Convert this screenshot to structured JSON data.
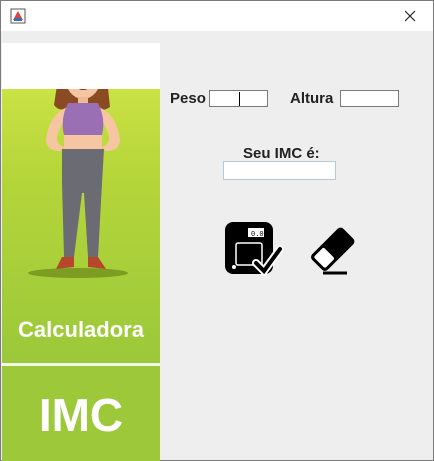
{
  "window": {
    "title": "",
    "icons": {
      "app": "calculator-app-icon",
      "close": "close-icon"
    }
  },
  "sidebar": {
    "image": "woman-illustration",
    "caption_line1": "Calculadora",
    "caption_line2": "IMC"
  },
  "form": {
    "peso_label": "Peso",
    "peso_value": "",
    "altura_label": "Altura",
    "altura_value": "",
    "result_label": "Seu IMC é:",
    "result_value": ""
  },
  "actions": {
    "calculate_icon": "scale-check-icon",
    "clear_icon": "eraser-icon"
  },
  "colors": {
    "panel_green": "#9cc83a",
    "background": "#eeeeee"
  }
}
